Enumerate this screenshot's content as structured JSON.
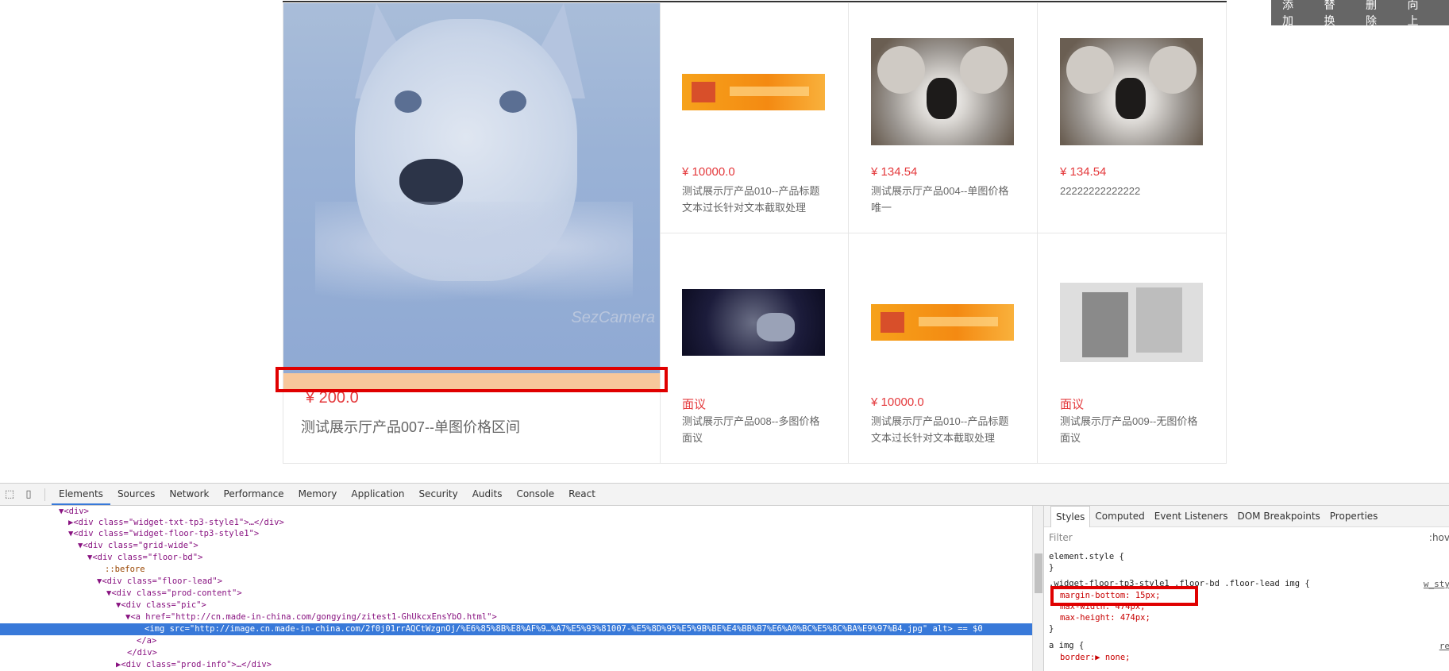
{
  "topbar": {
    "actions": [
      "添加",
      "替换",
      "删除",
      "向上"
    ]
  },
  "lead": {
    "price": "¥ 200.0",
    "title": "测试展示厅产品007--单图价格区间",
    "watermark": "SezCamera"
  },
  "grid": [
    {
      "price": "¥ 10000.0",
      "name": "测试展示厅产品010--产品标题文本过长针对文本截取处理",
      "thumb": "orange-banner-image"
    },
    {
      "price": "¥ 134.54",
      "name": "测试展示厅产品004--单图价格唯一",
      "thumb": "koala-image"
    },
    {
      "price": "¥ 134.54",
      "name": "22222222222222",
      "thumb": "koala-image"
    },
    {
      "price": "面议",
      "name": "测试展示厅产品008--多图价格面议",
      "thumb": "night-product-image"
    },
    {
      "price": "¥ 10000.0",
      "name": "测试展示厅产品010--产品标题文本过长针对文本截取处理",
      "thumb": "orange-banner-image"
    },
    {
      "price": "面议",
      "name": "测试展示厅产品009--无图价格面议",
      "thumb": "business-cards-image"
    }
  ],
  "devtools": {
    "tabs": [
      "Elements",
      "Sources",
      "Network",
      "Performance",
      "Memory",
      "Application",
      "Security",
      "Audits",
      "Console",
      "React"
    ],
    "dom": [
      {
        "text": "▼<div>"
      },
      {
        "text": "▶<div class=\"widget-txt-tp3-style1\">…</div>"
      },
      {
        "text": "▼<div class=\"widget-floor-tp3-style1\">"
      },
      {
        "text": "▼<div class=\"grid-wide\">"
      },
      {
        "text": "▼<div class=\"floor-bd\">"
      },
      {
        "text": "::before"
      },
      {
        "text": "▼<div class=\"floor-lead\">"
      },
      {
        "text": "▼<div class=\"prod-content\">"
      },
      {
        "text": "▼<div class=\"pic\">"
      },
      {
        "text": "▼<a href=\"http://cn.made-in-china.com/gongying/zitest1-GhUkcxEnsYbO.html\">"
      },
      {
        "text": "<img src=\"http://image.cn.made-in-china.com/2f0j01rrAQCtWzgnOj/%E6%85%8B%E8%AF%9…%A7%E5%93%81007-%E5%8D%95%E5%9B%BE%E4%BB%B7%E6%A0%BC%E5%8C%BA%E9%97%B4.jpg\" alt> == $0"
      },
      {
        "text": "</a>"
      },
      {
        "text": "</div>"
      },
      {
        "text": "▶<div class=\"prod-info\">…</div>"
      }
    ],
    "styles": {
      "tabs": [
        "Styles",
        "Computed",
        "Event Listeners",
        "DOM Breakpoints",
        "Properties"
      ],
      "filter": "Filter",
      "hov": ":hov",
      "element_style": "element.style {",
      "close": "}",
      "rule_selector": ".widget-floor-tp3-style1 .floor-bd .floor-lead img {",
      "rule_link": "w_sty",
      "prop1": "margin-bottom: 15px;",
      "prop2": "max-width: 474px;",
      "prop3": "max-height: 474px;",
      "rule2_selector": "a img {",
      "rule2_link": "re",
      "prop4": "border:▶ none;"
    }
  }
}
